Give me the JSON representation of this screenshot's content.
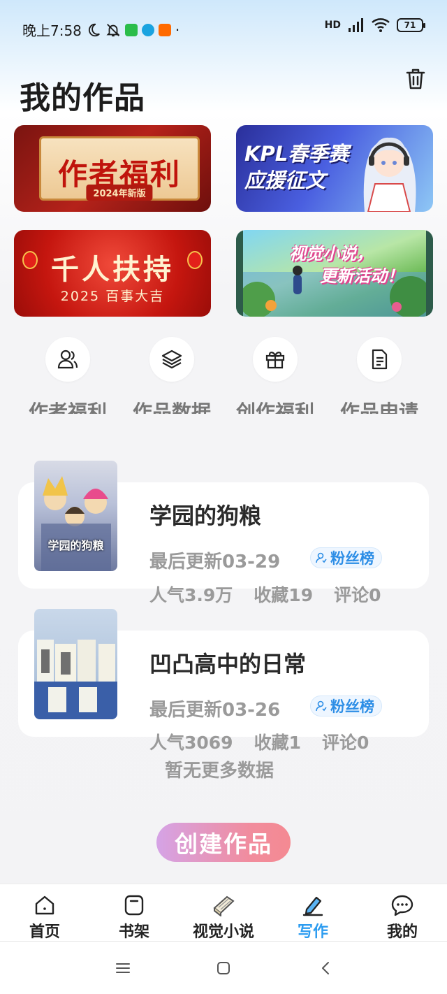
{
  "status_bar": {
    "time": "晚上7:58",
    "network": "HD",
    "battery": "71"
  },
  "page_title": "我的作品",
  "banners": {
    "author_welfare": {
      "title": "作者福利",
      "subtitle": "2024年新版"
    },
    "kpl": {
      "line1": "KPL春季赛",
      "line2": "应援征文"
    },
    "thousand_support": {
      "title": "千人扶持",
      "subtitle": "2025 百事大吉"
    },
    "visual_novel": {
      "line1": "视觉小说，",
      "line2": "更新活动！"
    }
  },
  "quick_actions": [
    {
      "label": "作者福利",
      "icon": "author-icon"
    },
    {
      "label": "作品数据",
      "icon": "layers-icon"
    },
    {
      "label": "创作福利",
      "icon": "gift-icon"
    },
    {
      "label": "作品申请",
      "icon": "document-icon"
    }
  ],
  "works": [
    {
      "cover_text": "学园的狗粮",
      "title": "学园的狗粮",
      "last_update": "最后更新03-29",
      "badge": "粉丝榜",
      "popularity": "人气3.9万",
      "favorites": "收藏19",
      "comments": "评论0"
    },
    {
      "cover_text": "",
      "title": "凹凸高中的日常",
      "last_update": "最后更新03-26",
      "badge": "粉丝榜",
      "popularity": "人气3069",
      "favorites": "收藏1",
      "comments": "评论0"
    }
  ],
  "no_more_text": "暂无更多数据",
  "create_button": "创建作品",
  "bottom_nav": [
    {
      "label": "首页",
      "icon": "home-icon",
      "active": false
    },
    {
      "label": "书架",
      "icon": "bookshelf-icon",
      "active": false
    },
    {
      "label": "视觉小说",
      "icon": "book-icon",
      "active": false
    },
    {
      "label": "写作",
      "icon": "pen-icon",
      "active": true
    },
    {
      "label": "我的",
      "icon": "chat-icon",
      "active": false
    }
  ],
  "colors": {
    "accent": "#2c9cf0",
    "create_gradient_start": "#d5a3e6",
    "create_gradient_end": "#f48a92"
  }
}
